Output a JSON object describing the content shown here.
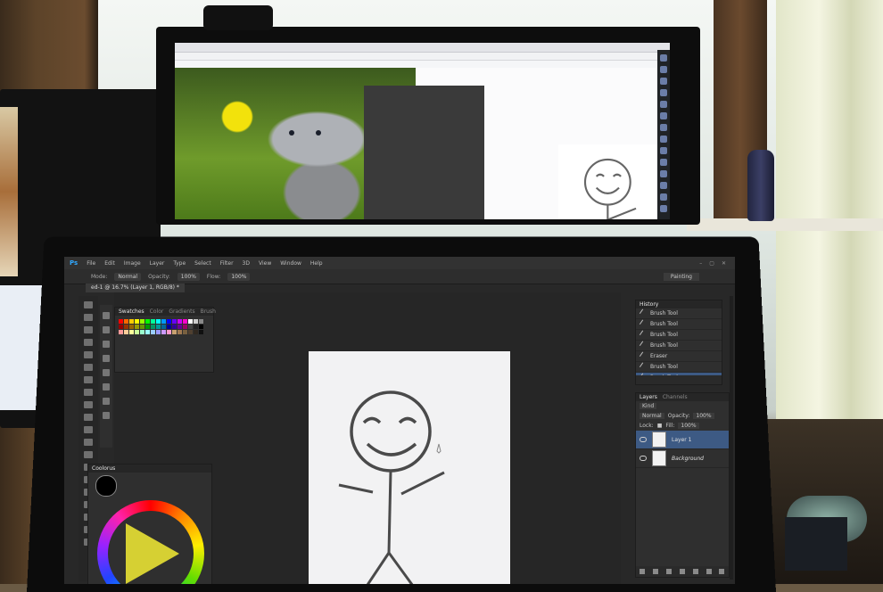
{
  "top_screen": {
    "sidebar_icons": 14
  },
  "photoshop": {
    "menu": [
      "File",
      "Edit",
      "Image",
      "Layer",
      "Type",
      "Select",
      "Filter",
      "3D",
      "View",
      "Window",
      "Help"
    ],
    "window_controls": [
      "–",
      "▢",
      "✕"
    ],
    "options_bar": {
      "mode_label": "Mode:",
      "mode_value": "Normal",
      "opacity_label": "Opacity:",
      "opacity_value": "100%",
      "flow_label": "Flow:",
      "flow_value": "100%",
      "workspace": "Painting"
    },
    "doc_tab": "ed-1 @ 16.7% (Layer 1, RGB/8) *",
    "swatches_tabs": [
      "Swatches",
      "Color",
      "Gradients",
      "Brush"
    ],
    "swatch_colors": [
      "#ff0000",
      "#ff6600",
      "#ffcc00",
      "#ffff00",
      "#99ff00",
      "#00ff00",
      "#00ff99",
      "#00ffff",
      "#0099ff",
      "#0000ff",
      "#6600ff",
      "#cc00ff",
      "#ff00cc",
      "#ffffff",
      "#cccccc",
      "#888888",
      "#990000",
      "#993300",
      "#996600",
      "#999900",
      "#669900",
      "#009900",
      "#009966",
      "#009999",
      "#006699",
      "#000099",
      "#330099",
      "#660099",
      "#990066",
      "#444444",
      "#222222",
      "#000000",
      "#ff9999",
      "#ffcc99",
      "#ffff99",
      "#ccff99",
      "#99ffcc",
      "#99ffff",
      "#99ccff",
      "#9999ff",
      "#cc99ff",
      "#ff99cc",
      "#c8a070",
      "#a07850",
      "#786040",
      "#504030",
      "#302820",
      "#101010"
    ],
    "coolorus_title": "Coolorus",
    "history": {
      "title": "History",
      "items": [
        "Brush Tool",
        "Brush Tool",
        "Brush Tool",
        "Brush Tool",
        "Eraser",
        "Brush Tool",
        "Brush Tool"
      ]
    },
    "layers": {
      "tabs": [
        "Layers",
        "Channels"
      ],
      "kind": "Kind",
      "blend": "Normal",
      "opacity_label": "Opacity:",
      "opacity_value": "100%",
      "lock_label": "Lock:",
      "fill_label": "Fill:",
      "fill_value": "100%",
      "items": [
        {
          "name": "Layer 1",
          "active": true
        },
        {
          "name": "Background",
          "active": false
        }
      ]
    }
  }
}
